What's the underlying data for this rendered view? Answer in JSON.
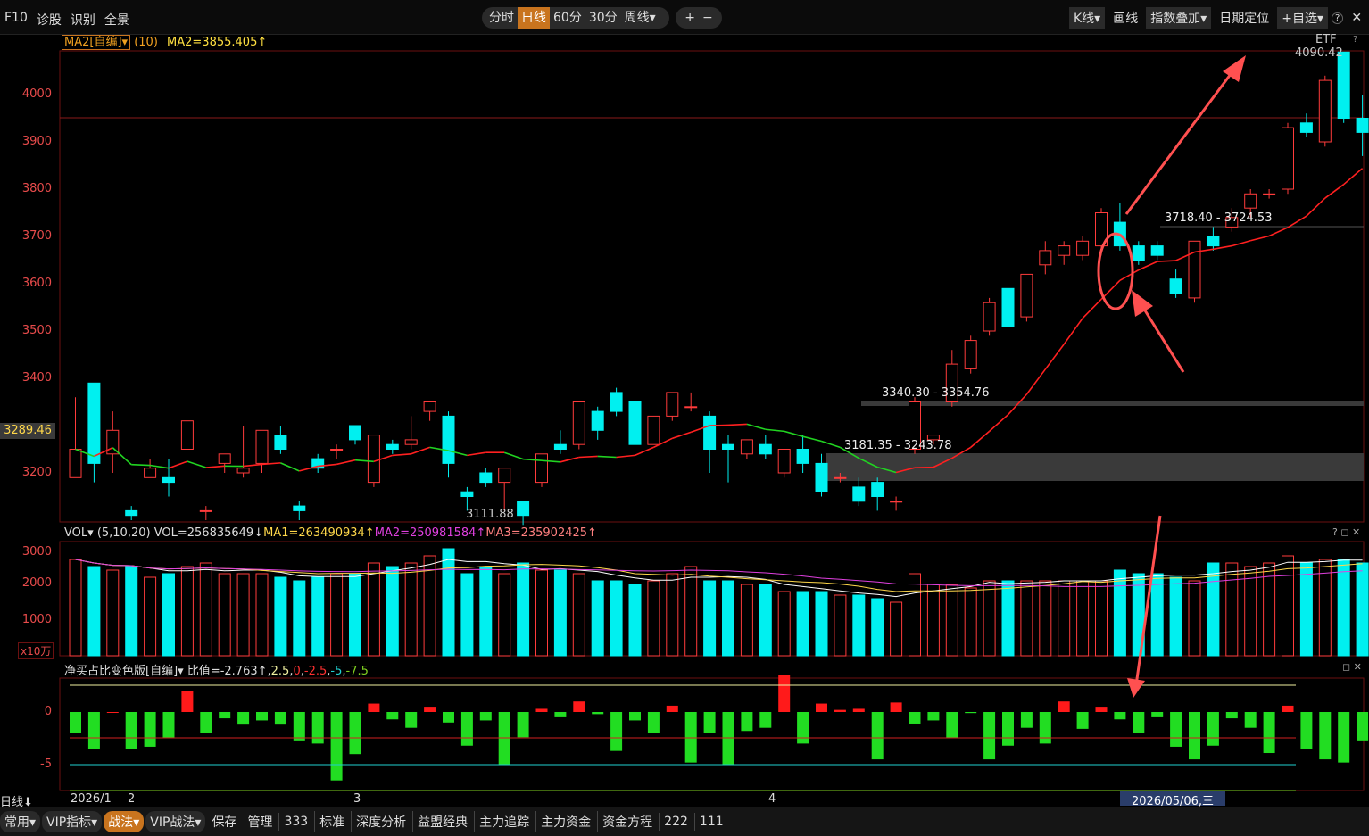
{
  "topbar": {
    "left_items": [
      "F10",
      "诊股",
      "识别",
      "全景"
    ],
    "period_tabs": [
      "分时",
      "日线",
      "60分",
      "30分",
      "周线▾"
    ],
    "active_tab": "日线",
    "zoom_in": "+",
    "zoom_out": "−",
    "right_items": [
      "K线▾",
      "画线",
      "指数叠加▾",
      "日期定位",
      "+自选▾"
    ],
    "help": "?",
    "close": "✕"
  },
  "indicator_header": {
    "ma_label": "MA2[自编]▾",
    "ma_param": "(10)",
    "ma_value": "MA2=3855.405↑",
    "etf": "ETF",
    "help": "?"
  },
  "price_axis": [
    "4000",
    "3900",
    "3800",
    "3700",
    "3600",
    "3500",
    "3400",
    "3200"
  ],
  "current_price": "3289.46",
  "annotations": {
    "high": "4090.42",
    "low": "3111.88",
    "gap1": "3718.40 - 3724.53",
    "gap2": "3340.30 - 3354.76",
    "gap3": "3181.35 - 3243.78"
  },
  "volume_header": {
    "label": "VOL▾",
    "params": "(5,10,20)",
    "vol": "VOL=256835649↓",
    "ma1": "MA1=263490934↑",
    "ma2": "MA2=250981584↑",
    "ma3": "MA3=235902425↑"
  },
  "volume_axis": [
    "3000",
    "2000",
    "1000"
  ],
  "volume_unit": "x10万",
  "netbuy_header": {
    "label": "净买占比变色版[自编]▾",
    "ratio": "比值=-2.763↑",
    "p1": "2.5",
    "p2": "0",
    "p3": "-2.5",
    "p4": "-5",
    "p5": "-7.5"
  },
  "netbuy_axis": [
    "0",
    "-5"
  ],
  "date_axis": {
    "period": "日线",
    "labels": [
      "2026/1",
      "2",
      "3",
      "4"
    ],
    "cursor_date": "2026/05/06,三"
  },
  "bottombar": {
    "items": [
      "常用▾",
      "VIP指标▾",
      "战法▾",
      "VIP战法▾",
      "保存",
      "管理",
      "333",
      "标准",
      "深度分析",
      "益盟经典",
      "主力追踪",
      "主力资金",
      "资金方程",
      "222",
      "111"
    ]
  },
  "colors": {
    "up": "#ff3b3b",
    "down": "#00f0f0",
    "ma_green": "#21d321",
    "ma_red": "#ff2020",
    "accent": "#c9741e"
  },
  "chart_data": {
    "type": "candlestick",
    "x_range": [
      "2026/1",
      "2026/05/06"
    ],
    "ylim": [
      3100,
      4100
    ],
    "candles": [
      {
        "o": 3190,
        "h": 3360,
        "c": 3250,
        "l": 3240
      },
      {
        "o": 3390,
        "h": 3390,
        "c": 3220,
        "l": 3180
      },
      {
        "o": 3240,
        "h": 3330,
        "c": 3290,
        "l": 3200
      },
      {
        "o": 3120,
        "h": 3130,
        "c": 3110,
        "l": 3100
      },
      {
        "o": 3190,
        "h": 3230,
        "c": 3210,
        "l": 3200
      },
      {
        "o": 3190,
        "h": 3230,
        "c": 3180,
        "l": 3150
      },
      {
        "o": 3250,
        "h": 3280,
        "c": 3310,
        "l": 3250
      },
      {
        "o": 3120,
        "h": 3130,
        "c": 3120,
        "l": 3100
      },
      {
        "o": 3220,
        "h": 3240,
        "c": 3240,
        "l": 3200
      },
      {
        "o": 3200,
        "h": 3300,
        "c": 3210,
        "l": 3190
      },
      {
        "o": 3220,
        "h": 3280,
        "c": 3290,
        "l": 3200
      },
      {
        "o": 3280,
        "h": 3300,
        "c": 3250,
        "l": 3240
      },
      {
        "o": 3130,
        "h": 3140,
        "c": 3120,
        "l": 3100
      },
      {
        "o": 3230,
        "h": 3240,
        "c": 3210,
        "l": 3200
      },
      {
        "o": 3250,
        "h": 3260,
        "c": 3250,
        "l": 3230
      },
      {
        "o": 3300,
        "h": 3300,
        "c": 3270,
        "l": 3260
      },
      {
        "o": 3180,
        "h": 3210,
        "c": 3280,
        "l": 3170
      },
      {
        "o": 3260,
        "h": 3270,
        "c": 3250,
        "l": 3240
      },
      {
        "o": 3260,
        "h": 3320,
        "c": 3270,
        "l": 3250
      },
      {
        "o": 3330,
        "h": 3350,
        "c": 3350,
        "l": 3310
      },
      {
        "o": 3320,
        "h": 3330,
        "c": 3220,
        "l": 3190
      },
      {
        "o": 3160,
        "h": 3170,
        "c": 3150,
        "l": 3120
      },
      {
        "o": 3200,
        "h": 3210,
        "c": 3180,
        "l": 3170
      },
      {
        "o": 3180,
        "h": 3190,
        "c": 3210,
        "l": 3120
      },
      {
        "o": 3140,
        "h": 3140,
        "c": 3110,
        "l": 3090
      },
      {
        "o": 3180,
        "h": 3180,
        "c": 3240,
        "l": 3170
      },
      {
        "o": 3260,
        "h": 3290,
        "c": 3250,
        "l": 3240
      },
      {
        "o": 3260,
        "h": 3270,
        "c": 3350,
        "l": 3250
      },
      {
        "o": 3330,
        "h": 3340,
        "c": 3290,
        "l": 3270
      },
      {
        "o": 3370,
        "h": 3380,
        "c": 3330,
        "l": 3320
      },
      {
        "o": 3350,
        "h": 3370,
        "c": 3260,
        "l": 3250
      },
      {
        "o": 3260,
        "h": 3280,
        "c": 3320,
        "l": 3260
      },
      {
        "o": 3320,
        "h": 3330,
        "c": 3370,
        "l": 3310
      },
      {
        "o": 3340,
        "h": 3370,
        "c": 3340,
        "l": 3330
      },
      {
        "o": 3320,
        "h": 3330,
        "c": 3250,
        "l": 3200
      },
      {
        "o": 3260,
        "h": 3280,
        "c": 3250,
        "l": 3180
      },
      {
        "o": 3240,
        "h": 3260,
        "c": 3270,
        "l": 3230
      },
      {
        "o": 3260,
        "h": 3280,
        "c": 3240,
        "l": 3230
      },
      {
        "o": 3200,
        "h": 3230,
        "c": 3250,
        "l": 3190
      },
      {
        "o": 3250,
        "h": 3280,
        "c": 3220,
        "l": 3200
      },
      {
        "o": 3220,
        "h": 3240,
        "c": 3160,
        "l": 3150
      },
      {
        "o": 3190,
        "h": 3200,
        "c": 3190,
        "l": 3180
      },
      {
        "o": 3170,
        "h": 3190,
        "c": 3140,
        "l": 3130
      },
      {
        "o": 3180,
        "h": 3190,
        "c": 3150,
        "l": 3120
      },
      {
        "o": 3140,
        "h": 3150,
        "c": 3140,
        "l": 3120
      },
      {
        "o": 3250,
        "h": 3360,
        "c": 3350,
        "l": 3240
      },
      {
        "o": 3270,
        "h": 3280,
        "c": 3280,
        "l": 3260
      },
      {
        "o": 3350,
        "h": 3460,
        "c": 3430,
        "l": 3340
      },
      {
        "o": 3420,
        "h": 3490,
        "c": 3480,
        "l": 3410
      },
      {
        "o": 3500,
        "h": 3570,
        "c": 3560,
        "l": 3490
      },
      {
        "o": 3590,
        "h": 3600,
        "c": 3510,
        "l": 3490
      },
      {
        "o": 3530,
        "h": 3620,
        "c": 3620,
        "l": 3520
      },
      {
        "o": 3640,
        "h": 3690,
        "c": 3670,
        "l": 3620
      },
      {
        "o": 3660,
        "h": 3690,
        "c": 3680,
        "l": 3640
      },
      {
        "o": 3660,
        "h": 3700,
        "c": 3690,
        "l": 3650
      },
      {
        "o": 3680,
        "h": 3760,
        "c": 3750,
        "l": 3660
      },
      {
        "o": 3730,
        "h": 3770,
        "c": 3680,
        "l": 3670
      },
      {
        "o": 3680,
        "h": 3690,
        "c": 3650,
        "l": 3640
      },
      {
        "o": 3680,
        "h": 3690,
        "c": 3660,
        "l": 3650
      },
      {
        "o": 3610,
        "h": 3630,
        "c": 3580,
        "l": 3570
      },
      {
        "o": 3570,
        "h": 3690,
        "c": 3690,
        "l": 3560
      },
      {
        "o": 3700,
        "h": 3720,
        "c": 3680,
        "l": 3670
      },
      {
        "o": 3720,
        "h": 3760,
        "c": 3740,
        "l": 3710
      },
      {
        "o": 3760,
        "h": 3800,
        "c": 3790,
        "l": 3740
      },
      {
        "o": 3790,
        "h": 3800,
        "c": 3790,
        "l": 3780
      },
      {
        "o": 3800,
        "h": 3940,
        "c": 3930,
        "l": 3790
      },
      {
        "o": 3940,
        "h": 3960,
        "c": 3920,
        "l": 3910
      },
      {
        "o": 3900,
        "h": 4040,
        "c": 4030,
        "l": 3890
      },
      {
        "o": 4090,
        "h": 4090,
        "c": 3950,
        "l": 3940
      },
      {
        "o": 3950,
        "h": 4000,
        "c": 3920,
        "l": 3870
      }
    ],
    "volume": [
      2700,
      2500,
      2400,
      2500,
      2200,
      2300,
      2500,
      2600,
      2300,
      2300,
      2300,
      2200,
      2100,
      2200,
      2300,
      2300,
      2600,
      2500,
      2600,
      2800,
      3000,
      2300,
      2500,
      2300,
      2600,
      2400,
      2400,
      2300,
      2100,
      2100,
      2000,
      2100,
      2300,
      2500,
      2100,
      2100,
      2000,
      2000,
      1800,
      1800,
      1800,
      1700,
      1700,
      1600,
      1500,
      2300,
      2000,
      2000,
      1900,
      2100,
      2100,
      2100,
      2100,
      2100,
      2100,
      2100,
      2400,
      2300,
      2300,
      2200,
      2100,
      2600,
      2600,
      2500,
      2600,
      2800,
      2600,
      2700,
      2700,
      2600
    ],
    "netbuy": [
      -2,
      -3.5,
      0,
      -3.5,
      -3.3,
      -2.5,
      2,
      -2,
      -0.6,
      -1.2,
      -0.8,
      -1.2,
      -2.7,
      -3,
      -6.5,
      -4,
      0.8,
      -0.7,
      -1.5,
      0.5,
      -1,
      -3.2,
      -0.8,
      -5,
      -2.4,
      0.3,
      -0.5,
      1,
      -0.2,
      -3.7,
      -0.8,
      -2,
      0.6,
      -4.8,
      -2,
      -5,
      -1.8,
      -1.5,
      3.5,
      -3,
      0.8,
      0.2,
      0.3,
      -4.5,
      0.9,
      -1.1,
      -0.8,
      -2.5,
      -0.1,
      -4.5,
      -3.2,
      -1.5,
      -3,
      1,
      -1.6,
      0.5,
      -0.7,
      -2,
      -0.5,
      -3.3,
      -4.5,
      -3.2,
      -0.6,
      -1.5,
      -3.9,
      0.6,
      -3.5,
      -4.5,
      -4.8,
      -2.7
    ]
  }
}
